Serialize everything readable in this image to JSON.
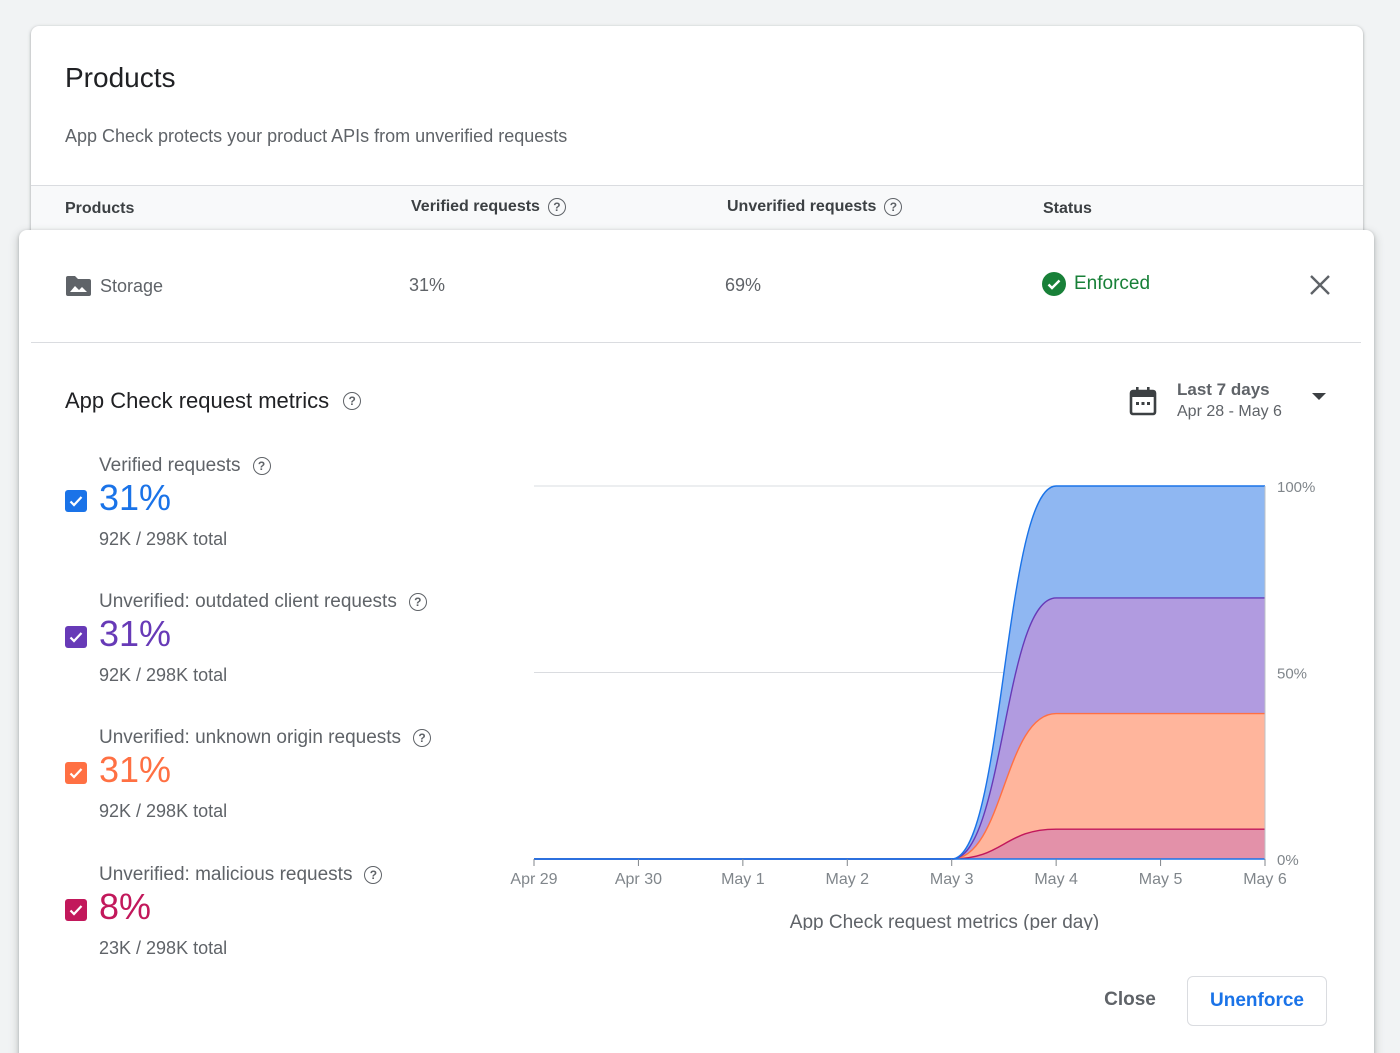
{
  "products_card": {
    "title": "Products",
    "subtitle": "App Check protects your product APIs from unverified requests",
    "columns": [
      "Products",
      "Verified requests",
      "Unverified requests",
      "Status"
    ]
  },
  "row": {
    "product": "Storage",
    "product_icon": "image-folder-icon",
    "verified": "31%",
    "unverified": "69%",
    "status": "Enforced",
    "status_color": "#188038"
  },
  "metrics": {
    "title": "App Check request metrics",
    "date_label": "Last 7 days",
    "date_range": "Apr 28 - May 6",
    "legend": [
      {
        "name": "Verified requests",
        "percent": "31%",
        "total": "92K / 298K total",
        "color": "#1a73e8",
        "checked": true
      },
      {
        "name": "Unverified: outdated client requests",
        "percent": "31%",
        "total": "92K / 298K total",
        "color": "#673ab7",
        "checked": true
      },
      {
        "name": "Unverified: unknown origin requests",
        "percent": "31%",
        "total": "92K / 298K total",
        "color": "#ff7043",
        "checked": true
      },
      {
        "name": "Unverified: malicious requests",
        "percent": "8%",
        "total": "23K / 298K total",
        "color": "#c2185b",
        "checked": true
      }
    ]
  },
  "chart_data": {
    "type": "area",
    "stacked": true,
    "x": [
      "Apr 29",
      "Apr 30",
      "May 1",
      "May 2",
      "May 3",
      "May 4",
      "May 5",
      "May 6"
    ],
    "xlabel": "App Check request metrics (per day)",
    "ylabel": "",
    "ylim": [
      0,
      100
    ],
    "yticks": [
      "0%",
      "50%",
      "100%"
    ],
    "y_axis_side": "right",
    "grid": true,
    "series": [
      {
        "name": "Unverified: malicious requests",
        "color": "#c2185b",
        "fill": "#e391a9",
        "values": [
          0,
          0,
          0,
          0,
          0,
          8,
          8,
          8
        ]
      },
      {
        "name": "Unverified: unknown origin requests",
        "color": "#ff7043",
        "fill": "#ffb59c",
        "values": [
          0,
          0,
          0,
          0,
          0,
          31,
          31,
          31
        ]
      },
      {
        "name": "Unverified: outdated client requests",
        "color": "#673ab7",
        "fill": "#b19be0",
        "values": [
          0,
          0,
          0,
          0,
          0,
          31,
          31,
          31
        ]
      },
      {
        "name": "Verified requests",
        "color": "#1a73e8",
        "fill": "#8fb7f2",
        "values": [
          0,
          0,
          0,
          0,
          0,
          30,
          30,
          30
        ]
      }
    ]
  },
  "actions": {
    "close": "Close",
    "unenforce": "Unenforce"
  }
}
